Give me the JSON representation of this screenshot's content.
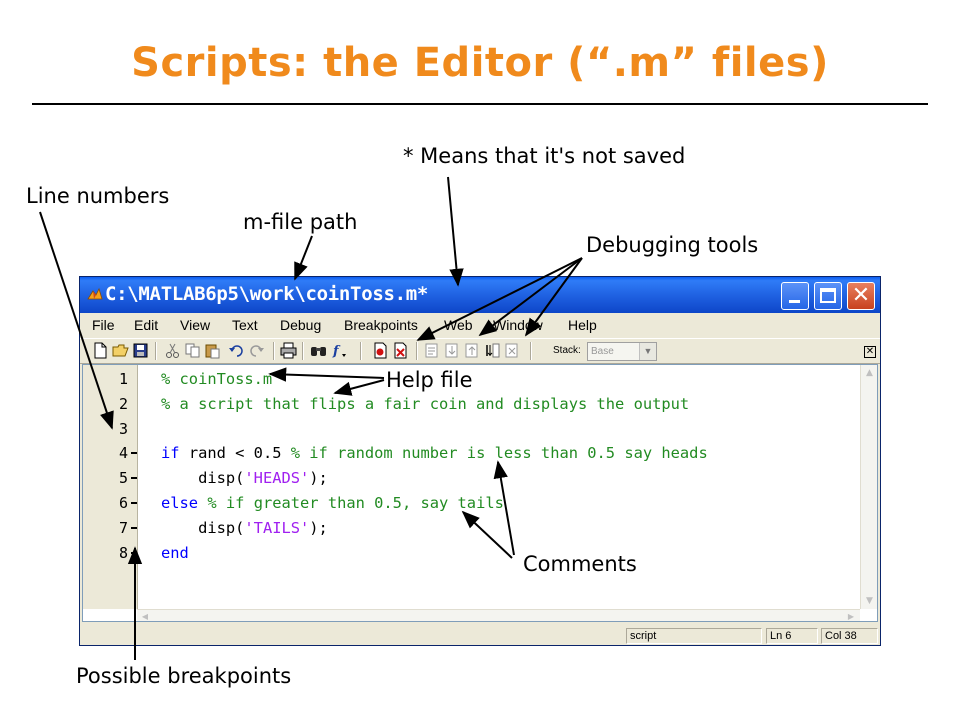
{
  "slide": {
    "title": "Scripts: the Editor (“.m” files)"
  },
  "callouts": {
    "not_saved": "* Means that it's not saved",
    "line_numbers": "Line numbers",
    "mfile_path": "m-file path",
    "debugging_tools": "Debugging tools",
    "help_file": "Help file",
    "comments": "Comments",
    "possible_breakpoints": "Possible breakpoints"
  },
  "window": {
    "title": "C:\\MATLAB6p5\\work\\coinToss.m*",
    "app_icon": "matlab-icon",
    "menu": [
      "File",
      "Edit",
      "View",
      "Text",
      "Debug",
      "Breakpoints",
      "Web",
      "Window",
      "Help"
    ],
    "toolbar": {
      "stack_label": "Stack:",
      "stack_value": "Base"
    },
    "editor": {
      "line_numbers": [
        "1",
        "2",
        "3",
        "4",
        "5",
        "6",
        "7",
        "8"
      ],
      "breakpoint_lines": [
        4,
        5,
        6,
        7,
        8
      ],
      "lines": [
        [
          {
            "t": "% coinToss.m",
            "c": "cm"
          }
        ],
        [
          {
            "t": "% a script that flips a fair coin and displays the output",
            "c": "cm"
          }
        ],
        [],
        [
          {
            "t": "if",
            "c": "kw"
          },
          {
            "t": " rand < 0.5 ",
            "c": "tx"
          },
          {
            "t": "% if random number is less than 0.5 say heads",
            "c": "cm"
          }
        ],
        [
          {
            "t": "    disp(",
            "c": "tx"
          },
          {
            "t": "'HEADS'",
            "c": "str"
          },
          {
            "t": ");",
            "c": "tx"
          }
        ],
        [
          {
            "t": "else",
            "c": "kw"
          },
          {
            "t": " ",
            "c": "tx"
          },
          {
            "t": "% if greater than 0.5, say tails",
            "c": "cm"
          }
        ],
        [
          {
            "t": "    disp(",
            "c": "tx"
          },
          {
            "t": "'TAILS'",
            "c": "str"
          },
          {
            "t": ");",
            "c": "tx"
          }
        ],
        [
          {
            "t": "end",
            "c": "kw"
          }
        ]
      ]
    },
    "status": {
      "mode": "script",
      "line": "Ln 6",
      "col": "Col 38"
    }
  },
  "colors": {
    "title": "#f08a1c",
    "comment": "#228b22",
    "keyword": "#0000ff",
    "string": "#a020f0",
    "titlebar": "#1e5fe0"
  }
}
